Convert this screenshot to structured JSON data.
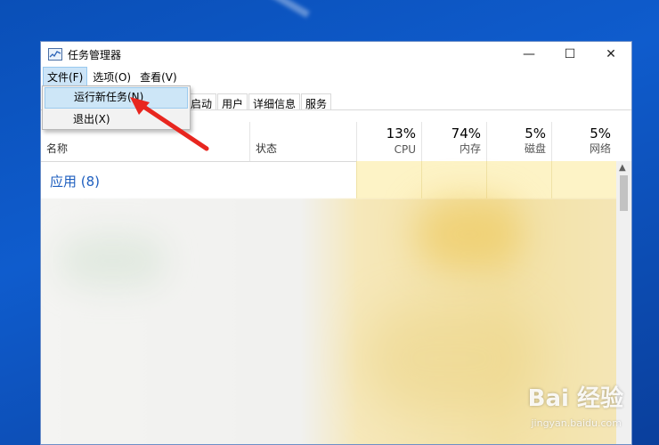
{
  "window": {
    "title": "任务管理器"
  },
  "controls": {
    "minimize": "—",
    "maximize": "☐",
    "close": "✕"
  },
  "menubar": {
    "file": "文件(F)",
    "options": "选项(O)",
    "view": "查看(V)"
  },
  "dropdown": {
    "items": [
      {
        "label": "运行新任务(N)"
      },
      {
        "label": "退出(X)"
      }
    ]
  },
  "tabs": {
    "items": [
      {
        "label": "启动"
      },
      {
        "label": "用户"
      },
      {
        "label": "详细信息"
      },
      {
        "label": "服务"
      }
    ]
  },
  "columns": {
    "name": "名称",
    "status": "状态",
    "resources": [
      {
        "percent": "13%",
        "label": "CPU"
      },
      {
        "percent": "74%",
        "label": "内存"
      },
      {
        "percent": "5%",
        "label": "磁盘"
      },
      {
        "percent": "5%",
        "label": "网络"
      }
    ]
  },
  "section": {
    "label": "应用 (8)"
  },
  "watermark": {
    "brand": "Bai 经验",
    "url": "jingyan.baidu.com"
  }
}
